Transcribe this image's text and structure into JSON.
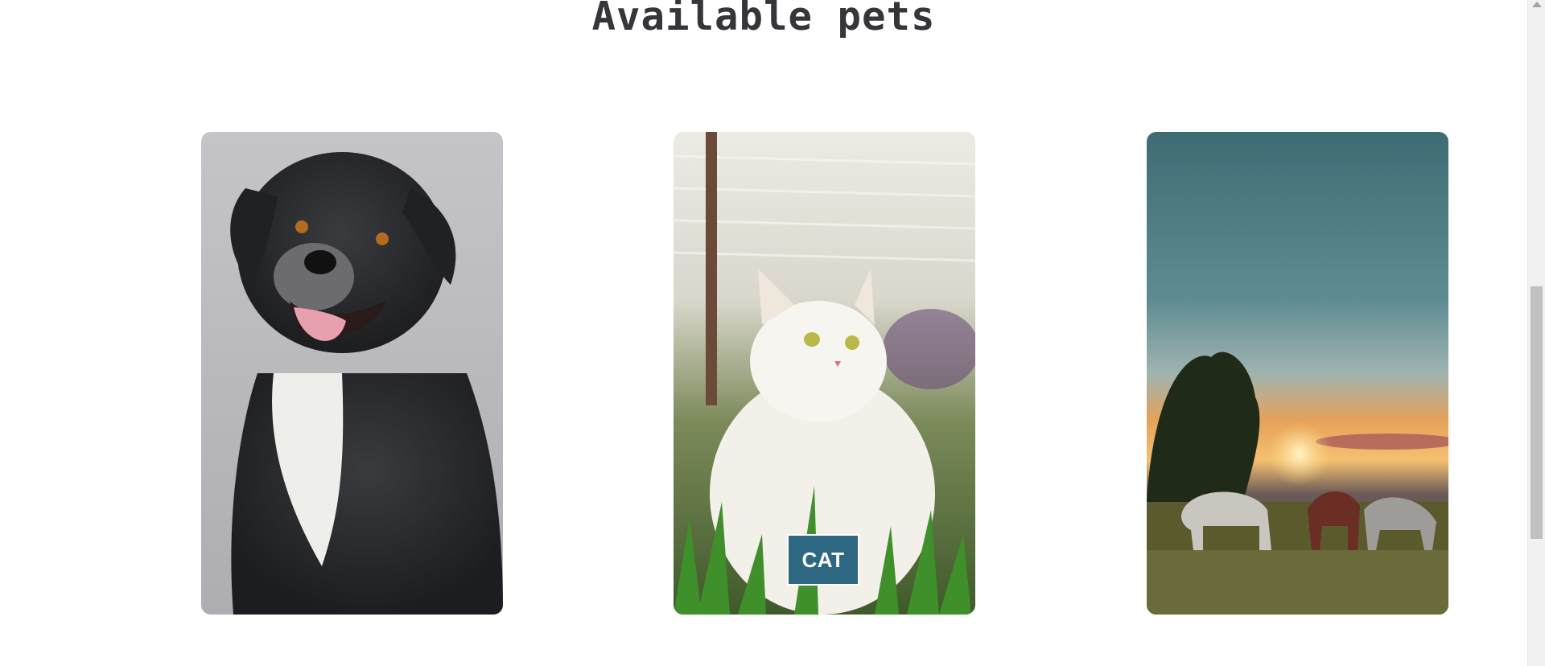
{
  "section": {
    "title": "Available pets"
  },
  "pets": [
    {
      "name": "dog",
      "image": "dog-photo",
      "label": ""
    },
    {
      "name": "cat",
      "image": "cat-photo",
      "label": "CAT"
    },
    {
      "name": "horse",
      "image": "horses-sunset-photo",
      "label": ""
    }
  ],
  "colors": {
    "title": "#35363a",
    "label_bg": "#2d6782",
    "label_text": "#ffffff"
  }
}
